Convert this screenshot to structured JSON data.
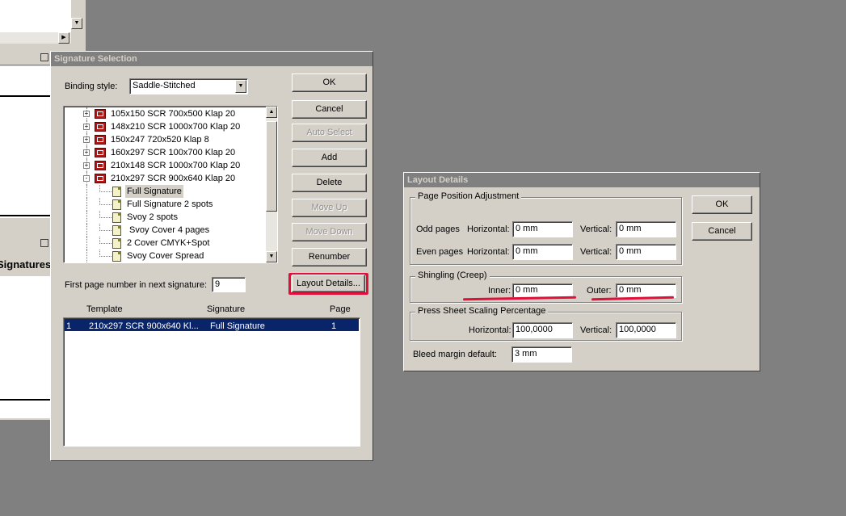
{
  "background_window": {
    "signatures_header": "Signatures"
  },
  "signature_dialog": {
    "title": "Signature Selection",
    "binding_label": "Binding style:",
    "binding_value": "Saddle-Stitched",
    "tree": [
      {
        "label": "105x150 SCR 700x500 Klap 20",
        "type": "template",
        "expander": "+"
      },
      {
        "label": "148x210 SCR 1000x700 Klap 20",
        "type": "template",
        "expander": "+"
      },
      {
        "label": "150x247 720x520 Klap 8",
        "type": "template",
        "expander": "+"
      },
      {
        "label": "160x297 SCR 100x700 Klap 20",
        "type": "template",
        "expander": "+"
      },
      {
        "label": "210x148 SCR 1000x700 Klap 20",
        "type": "template",
        "expander": "+"
      },
      {
        "label": "210x297 SCR 900x640 Klap 20",
        "type": "template",
        "expander": "-"
      },
      {
        "label": "Full Signature",
        "type": "child",
        "selected": true
      },
      {
        "label": "Full Signature 2 spots",
        "type": "child"
      },
      {
        "label": "Svoy 2 spots",
        "type": "child"
      },
      {
        "label": " Svoy Cover 4 pages",
        "type": "child"
      },
      {
        "label": "2 Cover CMYK+Spot",
        "type": "child"
      },
      {
        "label": "Svoy Cover Spread",
        "type": "child"
      }
    ],
    "buttons": {
      "ok": "OK",
      "cancel": "Cancel",
      "auto_select": "Auto Select",
      "add": "Add",
      "delete": "Delete",
      "move_up": "Move Up",
      "move_down": "Move Down",
      "renumber": "Renumber",
      "layout_details": "Layout Details..."
    },
    "first_page_label": "First page number in next signature:",
    "first_page_value": "9",
    "table": {
      "headers": [
        "Template",
        "Signature",
        "Page"
      ],
      "rows": [
        {
          "index": "1",
          "template": "210x297 SCR 900x640 Kl...",
          "signature": "Full Signature",
          "page": "1"
        }
      ]
    }
  },
  "layout_dialog": {
    "title": "Layout Details",
    "ok": "OK",
    "cancel": "Cancel",
    "page_position": {
      "title": "Page Position Adjustment",
      "odd_label": "Odd pages",
      "even_label": "Even pages",
      "horizontal_label": "Horizontal:",
      "vertical_label": "Vertical:",
      "odd_h": "0 mm",
      "odd_v": "0 mm",
      "even_h": "0 mm",
      "even_v": "0 mm"
    },
    "shingling": {
      "title": "Shingling (Creep)",
      "inner_label": "Inner:",
      "inner_value": "0 mm",
      "outer_label": "Outer:",
      "outer_value": "0 mm"
    },
    "scaling": {
      "title": "Press Sheet Scaling Percentage",
      "horizontal_label": "Horizontal:",
      "horizontal_value": "100,0000",
      "vertical_label": "Vertical:",
      "vertical_value": "100,0000"
    },
    "bleed_label": "Bleed margin default:",
    "bleed_value": "3 mm"
  },
  "colors": {
    "desktop": "#808080",
    "dialog": "#d4d0c8",
    "selection": "#0a246a",
    "highlight": "#e0103a"
  },
  "icons": {
    "template": "signature-template-icon",
    "child": "signature-page-icon",
    "dropdown": "chevron-down-icon"
  }
}
